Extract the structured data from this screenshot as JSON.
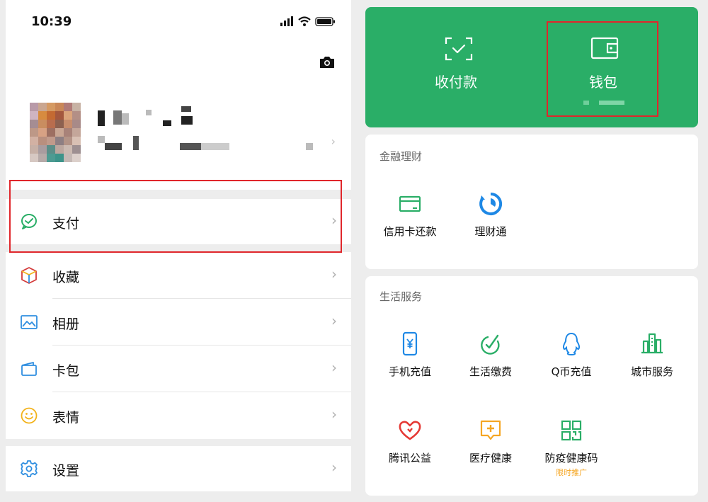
{
  "status_bar": {
    "time": "10:39"
  },
  "menu": {
    "pay": "支付",
    "favorites": "收藏",
    "album": "相册",
    "cards": "卡包",
    "stickers": "表情",
    "settings": "设置"
  },
  "wallet_header": {
    "receive_pay": "收付款",
    "wallet": "钱包"
  },
  "finance": {
    "title": "金融理财",
    "items": [
      "信用卡还款",
      "理财通"
    ]
  },
  "life": {
    "title": "生活服务",
    "items": [
      "手机充值",
      "生活缴费",
      "Q币充值",
      "城市服务",
      "腾讯公益",
      "医疗健康",
      "防疫健康码"
    ],
    "health_code_sub": "限时推广"
  },
  "colors": {
    "wechat_green": "#2aae67",
    "highlight_red": "#e0262b",
    "promo_orange": "#f5a623"
  }
}
